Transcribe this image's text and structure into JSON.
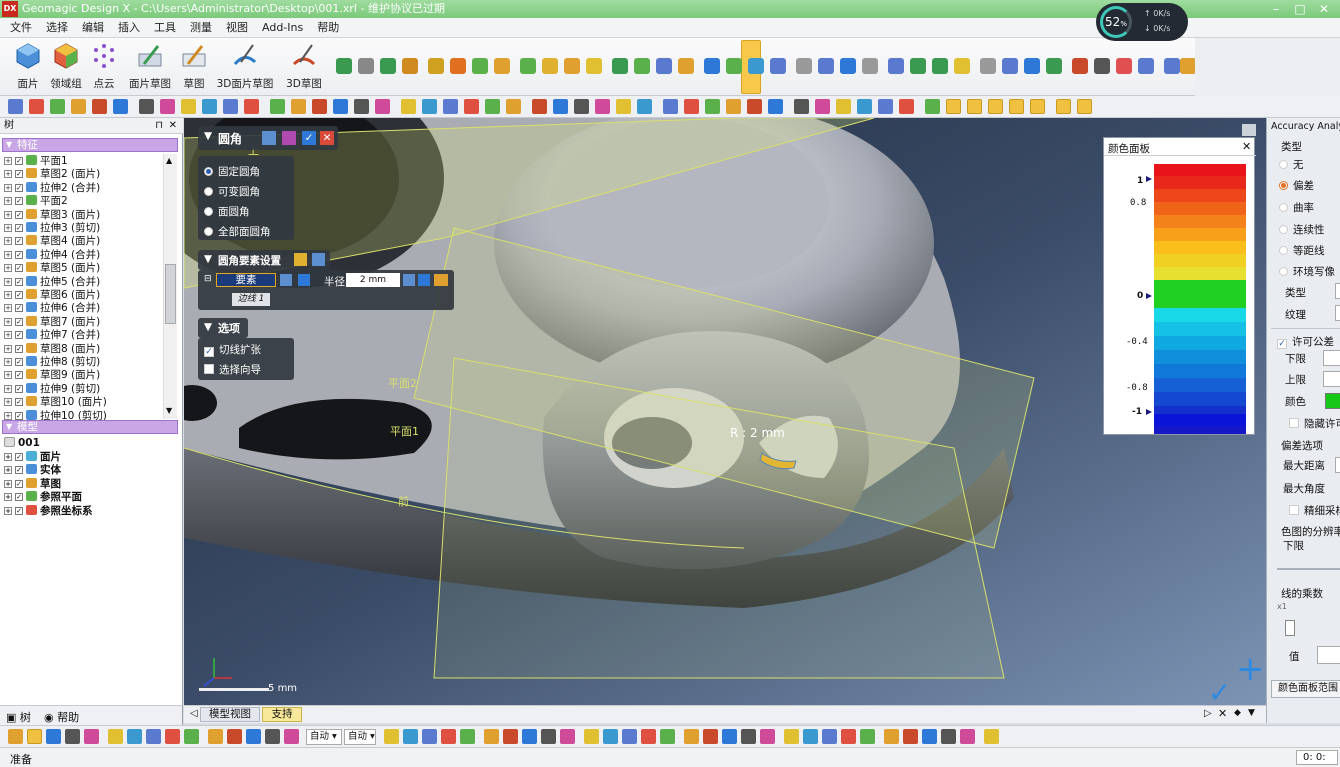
{
  "window": {
    "title": "Geomagic Design X - C:\\Users\\Administrator\\Desktop\\001.xrl - 维护协议已过期",
    "logo": "DX"
  },
  "menu": [
    "文件",
    "选择",
    "编辑",
    "插入",
    "工具",
    "测量",
    "视图",
    "Add-Ins",
    "帮助"
  ],
  "perf": {
    "percent": "52",
    "percent_sign": "%",
    "up": "0K/s",
    "down": "0K/s"
  },
  "ribbon": {
    "big_buttons": [
      {
        "label": "面片",
        "icon": "mesh-icon",
        "color": "#4a8fd8"
      },
      {
        "label": "领域组",
        "icon": "region-group-icon",
        "color": "#e06040"
      },
      {
        "label": "点云",
        "icon": "point-cloud-icon",
        "color": "#8a50c8"
      },
      {
        "label": "面片草图",
        "icon": "mesh-sketch-icon",
        "color": "#3a9a50"
      },
      {
        "label": "草图",
        "icon": "sketch-icon",
        "color": "#d08a20"
      },
      {
        "label": "3D面片草图",
        "icon": "3d-mesh-sketch-icon",
        "color": "#2a7ac8"
      },
      {
        "label": "3D草图",
        "icon": "3d-sketch-icon",
        "color": "#c84a2a"
      }
    ]
  },
  "tree": {
    "panel_title": "树",
    "features_label": "特征",
    "features": [
      {
        "label": "平面1",
        "icon": "plane-icon"
      },
      {
        "label": "草图2 (面片)",
        "icon": "sketch-icon"
      },
      {
        "label": "拉伸2 (合并)",
        "icon": "extrude-icon"
      },
      {
        "label": "平面2",
        "icon": "plane-icon"
      },
      {
        "label": "草图3 (面片)",
        "icon": "sketch-icon"
      },
      {
        "label": "拉伸3 (剪切)",
        "icon": "extrude-icon"
      },
      {
        "label": "草图4 (面片)",
        "icon": "sketch-icon"
      },
      {
        "label": "拉伸4 (合并)",
        "icon": "extrude-icon"
      },
      {
        "label": "草图5 (面片)",
        "icon": "sketch-icon"
      },
      {
        "label": "拉伸5 (合并)",
        "icon": "extrude-icon"
      },
      {
        "label": "草图6 (面片)",
        "icon": "sketch-icon"
      },
      {
        "label": "拉伸6 (合并)",
        "icon": "extrude-icon"
      },
      {
        "label": "草图7 (面片)",
        "icon": "sketch-icon"
      },
      {
        "label": "拉伸7 (合并)",
        "icon": "extrude-icon"
      },
      {
        "label": "草图8 (面片)",
        "icon": "sketch-icon"
      },
      {
        "label": "拉伸8 (剪切)",
        "icon": "extrude-icon"
      },
      {
        "label": "草图9 (面片)",
        "icon": "sketch-icon"
      },
      {
        "label": "拉伸9 (剪切)",
        "icon": "extrude-icon"
      },
      {
        "label": "草图10 (面片)",
        "icon": "sketch-icon"
      },
      {
        "label": "拉伸10 (剪切)",
        "icon": "extrude-icon"
      }
    ],
    "model_label": "模型",
    "model_root": "001",
    "model_items": [
      "面片",
      "实体",
      "草图",
      "参照平面",
      "参照坐标系"
    ],
    "tabs": [
      "树",
      "帮助"
    ]
  },
  "fillet_dialog": {
    "title": "圆角",
    "modes": [
      "固定圆角",
      "可变圆角",
      "面圆角",
      "全部面圆角"
    ],
    "selected_mode": 0,
    "element_section": "圆角要素设置",
    "element_label": "要素",
    "radius_label": "半径",
    "radius_value": "2 mm",
    "edge_item": "边线 1",
    "options_title": "选项",
    "options": [
      {
        "label": "切线扩张",
        "checked": true
      },
      {
        "label": "选择向导",
        "checked": false
      }
    ]
  },
  "viewport": {
    "labels": {
      "plane1": "平面1",
      "plane2": "平面2",
      "front": "前",
      "top": "上",
      "radius": "R : 2 mm"
    },
    "scale_label": "5",
    "scale_unit": "mm",
    "tabs": [
      "模型视图",
      "支持"
    ]
  },
  "color_panel": {
    "title": "颜色面板",
    "ticks": [
      "1",
      "0.8",
      "0",
      "-0.4",
      "-0.8",
      "-1"
    ]
  },
  "accuracy": {
    "title": "Accuracy Analyzer(TM)",
    "type_label": "类型",
    "types": [
      "无",
      "偏差",
      "曲率",
      "连续性",
      "等距线",
      "环境写像"
    ],
    "selected_type": 1,
    "type_field": "类型",
    "texture_field": "纹理",
    "tolerance_label": "许可公差",
    "lower": "下限",
    "upper": "上限",
    "color": "颜色",
    "hide": "隐藏许可",
    "deviation_options": "偏差选项",
    "max_distance": "最大距离",
    "max_angle": "最大角度",
    "fine_sampling": "精细采样",
    "colormap_resolution": "色图的分辨率",
    "colormap_lower": "下限",
    "line_multiplier": "线的乘数",
    "multiplier_value": "x1",
    "value_label": "值",
    "range_button": "颜色面板范围"
  },
  "toolbar3": {
    "dropdown1": "自动",
    "dropdown2": "自动"
  },
  "status": {
    "left": "准备",
    "right": "0: 0:"
  }
}
